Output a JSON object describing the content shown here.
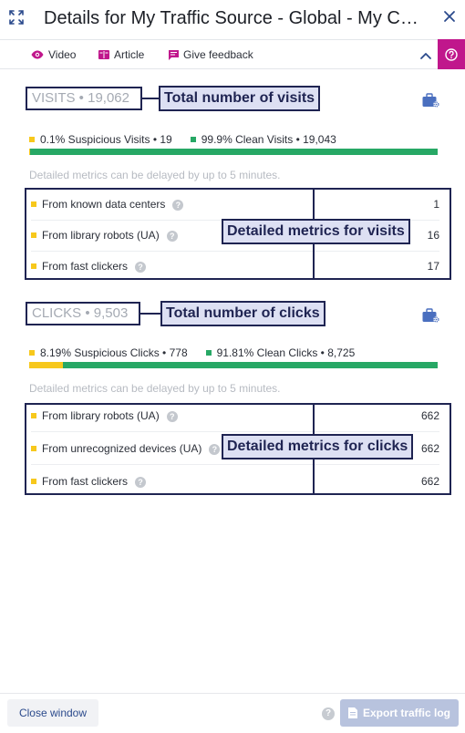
{
  "window": {
    "title": "Details for My Traffic Source - Global - My Campaign",
    "expand_icon": "expand-arrows-icon",
    "close_icon": "close-x-icon"
  },
  "toolbar": {
    "video_label": "Video",
    "article_label": "Article",
    "feedback_label": "Give feedback",
    "accent": "#c0178c"
  },
  "visits": {
    "heading": "VISITS • 19,062",
    "annotation": "Total number of visits",
    "suspicious_label": "0.1% Suspicious Visits • 19",
    "clean_label": "99.9% Clean Visits • 19,043",
    "suspicious_fraction": 0.001,
    "delay_note": "Detailed metrics can be delayed by up to 5 minutes.",
    "details_annotation": "Detailed metrics for visits",
    "metrics": [
      {
        "label": "From known data centers",
        "value": "1"
      },
      {
        "label": "From library robots (UA)",
        "value": "16"
      },
      {
        "label": "From fast clickers",
        "value": "17"
      }
    ]
  },
  "clicks": {
    "heading": "CLICKS • 9,503",
    "annotation": "Total number of clicks",
    "suspicious_label": "8.19% Suspicious Clicks • 778",
    "clean_label": "91.81% Clean Clicks • 8,725",
    "suspicious_fraction": 0.0819,
    "delay_note": "Detailed metrics can be delayed by up to 5 minutes.",
    "details_annotation": "Detailed metrics for clicks",
    "metrics": [
      {
        "label": "From library robots (UA)",
        "value": "662"
      },
      {
        "label": "From unrecognized devices (UA)",
        "value": "662"
      },
      {
        "label": "From fast clickers",
        "value": "662"
      }
    ]
  },
  "colors": {
    "suspicious": "#f7c81c",
    "clean": "#27a865",
    "annotation_border": "#1f2452"
  },
  "footer": {
    "close_label": "Close window",
    "export_label": "Export traffic log",
    "help_glyph": "?"
  }
}
